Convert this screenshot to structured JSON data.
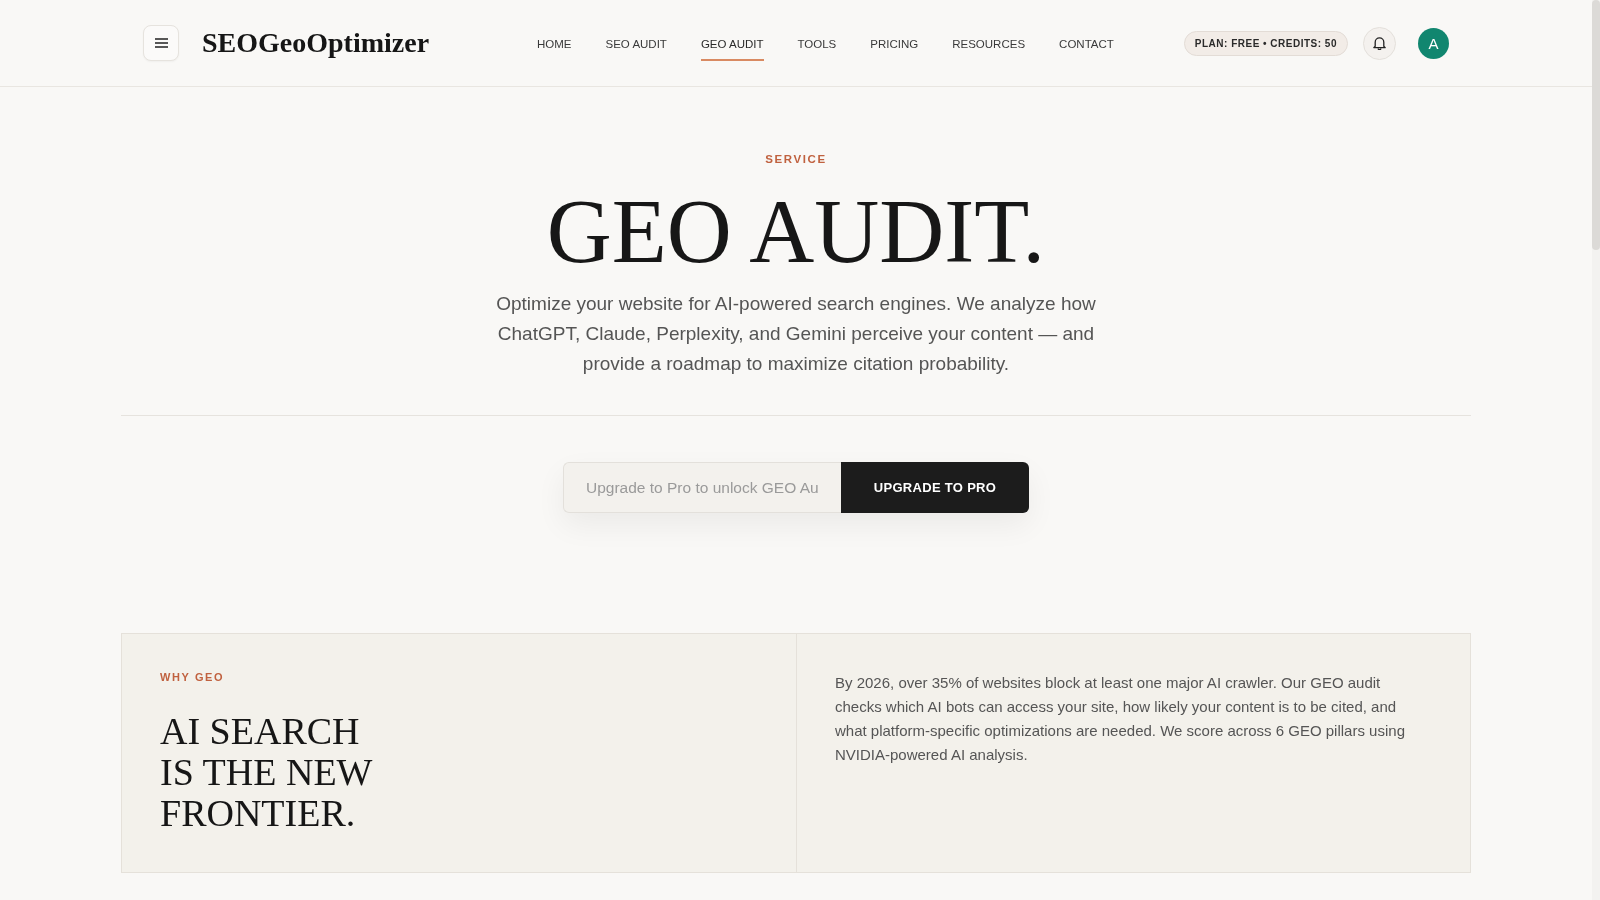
{
  "header": {
    "logo": "SEOGeoOptimizer",
    "nav": [
      {
        "label": "HOME",
        "selected": false
      },
      {
        "label": "SEO AUDIT",
        "selected": false
      },
      {
        "label": "GEO AUDIT",
        "selected": true
      },
      {
        "label": "TOOLS",
        "selected": false
      },
      {
        "label": "PRICING",
        "selected": false
      },
      {
        "label": "RESOURCES",
        "selected": false
      },
      {
        "label": "CONTACT",
        "selected": false
      }
    ],
    "plan_badge": "PLAN: FREE • CREDITS: 50",
    "avatar": "A"
  },
  "hero": {
    "eyebrow": "SERVICE",
    "title": "GEO AUDIT.",
    "description": "Optimize your website for AI-powered search engines. We analyze how ChatGPT, Claude, Perplexity, and Gemini perceive your content — and provide a roadmap to maximize citation probability."
  },
  "upgrade_form": {
    "placeholder": "Upgrade to Pro to unlock GEO Au",
    "button": "UPGRADE TO PRO"
  },
  "why_geo": {
    "eyebrow": "WHY GEO",
    "heading": "AI SEARCH IS THE NEW FRONTIER.",
    "body": "By 2026, over 35% of websites block at least one major AI crawler. Our GEO audit checks which AI bots can access your site, how likely your content is to be cited, and what platform-specific optimizations are needed. We score across 6 GEO pillars using NVIDIA-powered AI analysis."
  }
}
